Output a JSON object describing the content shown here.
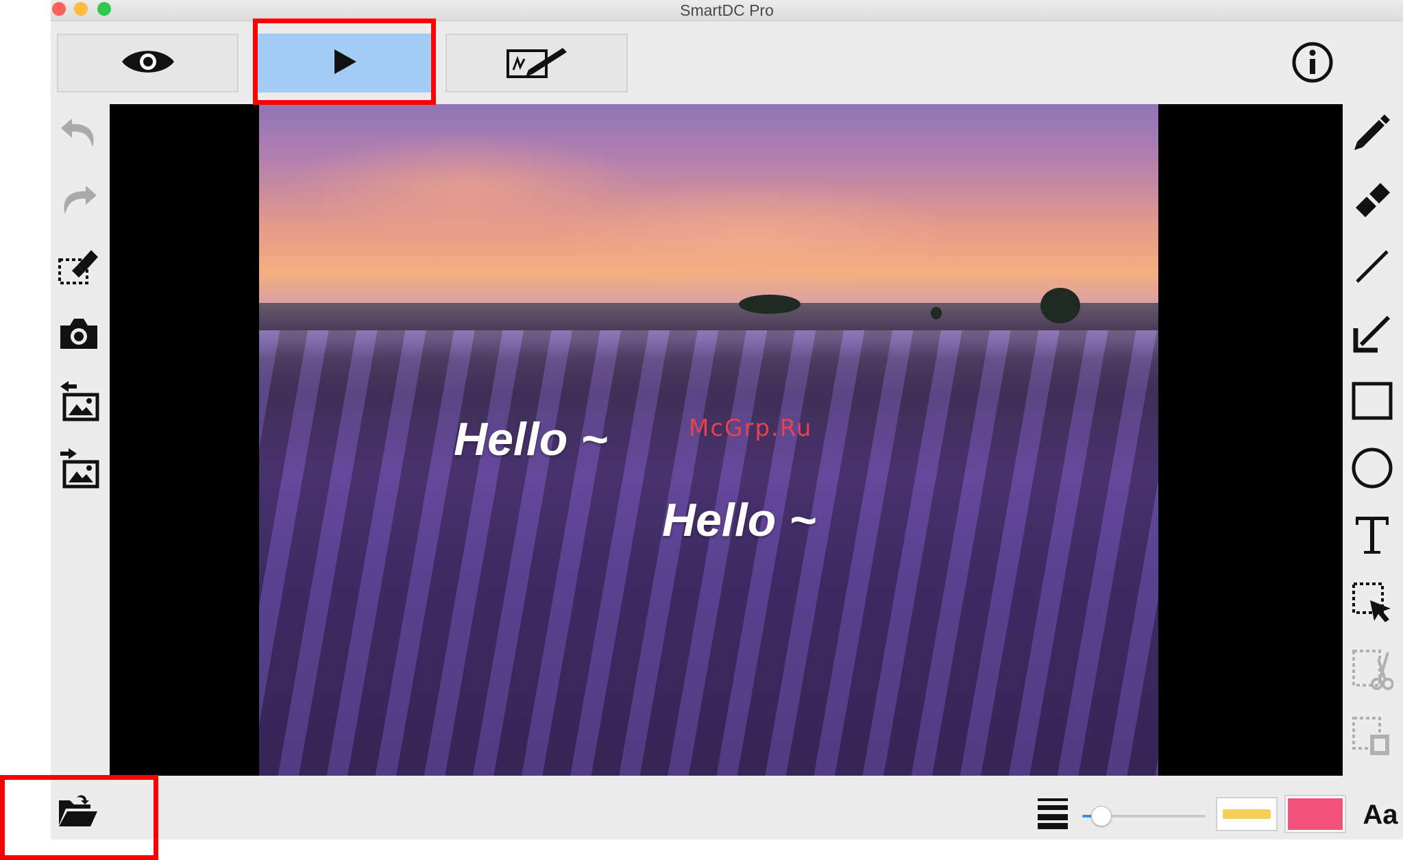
{
  "window": {
    "title": "SmartDC Pro"
  },
  "toolbar": {
    "modes": [
      {
        "name": "preview",
        "icon": "eye-icon",
        "active": false
      },
      {
        "name": "play",
        "icon": "play-icon",
        "active": true
      },
      {
        "name": "annotate",
        "icon": "whiteboard-pen-icon",
        "active": false
      }
    ],
    "info_icon": "info-icon"
  },
  "left_tools": [
    {
      "icon": "undo-icon",
      "enabled": false
    },
    {
      "icon": "redo-icon",
      "enabled": false
    },
    {
      "icon": "clear-selection-eraser-icon",
      "enabled": true
    },
    {
      "icon": "camera-icon",
      "enabled": true
    },
    {
      "icon": "import-image-icon",
      "enabled": true
    },
    {
      "icon": "export-image-icon",
      "enabled": true
    }
  ],
  "right_tools": [
    {
      "icon": "pen-icon",
      "enabled": true
    },
    {
      "icon": "eraser-icon",
      "enabled": true
    },
    {
      "icon": "line-icon",
      "enabled": true
    },
    {
      "icon": "arrow-icon",
      "enabled": true
    },
    {
      "icon": "rectangle-icon",
      "enabled": true
    },
    {
      "icon": "circle-icon",
      "enabled": true
    },
    {
      "icon": "text-icon",
      "enabled": true
    },
    {
      "icon": "select-icon",
      "enabled": true
    },
    {
      "icon": "cut-icon",
      "enabled": false
    },
    {
      "icon": "paste-icon",
      "enabled": false
    }
  ],
  "canvas": {
    "annotations": [
      {
        "text": "Hello ~"
      },
      {
        "text": "Hello ~"
      }
    ],
    "watermark": "McGrp.Ru"
  },
  "bottom_bar": {
    "open_icon": "folder-open-icon",
    "line_weight_icon": "line-weight-icon",
    "slider_level": 0.15,
    "stroke_color": "#f5cf5a",
    "fill_color": "#f2527a",
    "font_label": "Aa"
  },
  "colors": {
    "active_mode": "#a3cdf6",
    "highlight": "#ff0000",
    "slider_accent": "#3a8ff0"
  }
}
